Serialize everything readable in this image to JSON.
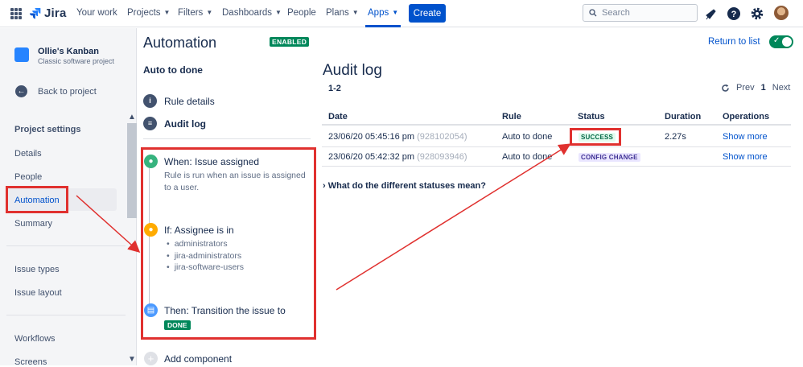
{
  "topnav": {
    "logo": "Jira",
    "items": [
      {
        "label": "Your work",
        "dropdown": false
      },
      {
        "label": "Projects",
        "dropdown": true
      },
      {
        "label": "Filters",
        "dropdown": true
      },
      {
        "label": "Dashboards",
        "dropdown": true
      },
      {
        "label": "People",
        "dropdown": false
      },
      {
        "label": "Plans",
        "dropdown": true
      },
      {
        "label": "Apps",
        "dropdown": true,
        "active": true
      }
    ],
    "create_label": "Create",
    "search_placeholder": "Search",
    "icons": [
      "app-switcher-icon",
      "notifications-icon",
      "help-icon",
      "settings-icon",
      "avatar"
    ]
  },
  "sidebar": {
    "project_name": "Ollie's Kanban",
    "project_type": "Classic software project",
    "back_label": "Back to project",
    "section_heading": "Project settings",
    "items": [
      "Details",
      "People",
      "Automation",
      "Summary",
      "Issue types",
      "Issue layout",
      "Workflows",
      "Screens"
    ],
    "active_item": "Automation"
  },
  "rule": {
    "page_title": "Automation",
    "status_badge": "ENABLED",
    "rule_name": "Auto to done",
    "menu": [
      {
        "label": "Rule details",
        "icon": "info-icon"
      },
      {
        "label": "Audit log",
        "icon": "list-icon",
        "active": true
      }
    ],
    "components": [
      {
        "title": "When: Issue assigned",
        "description": "Rule is run when an issue is assigned to a user.",
        "icon": "trigger-user-icon",
        "color": "#36b37e"
      },
      {
        "title": "If: Assignee is in",
        "list": [
          "administrators",
          "jira-administrators",
          "jira-software-users"
        ],
        "icon": "condition-user-icon",
        "color": "#ffab00"
      },
      {
        "title": "Then: Transition the issue to",
        "lozenge": "DONE",
        "icon": "action-transition-icon",
        "color": "#4c9aff"
      }
    ],
    "add_component_label": "Add component"
  },
  "audit": {
    "return_link": "Return to list",
    "title": "Audit log",
    "range": "1-2",
    "pager": {
      "prev": "Prev",
      "current": "1",
      "next": "Next"
    },
    "columns": [
      "Date",
      "Rule",
      "Status",
      "Duration",
      "Operations"
    ],
    "rows": [
      {
        "date": "23/06/20 05:45:16 pm",
        "id": "(928102054)",
        "rule": "Auto to done",
        "status": "SUCCESS",
        "duration": "2.27s",
        "operation": "Show more"
      },
      {
        "date": "23/06/20 05:42:32 pm",
        "id": "(928093946)",
        "rule": "Auto to done",
        "status": "CONFIG CHANGE",
        "duration": "",
        "operation": "Show more"
      }
    ],
    "faq": "What do the different statuses mean?"
  },
  "colors": {
    "brand": "#0052cc",
    "success": "#00875a",
    "annotation": "#e0312f"
  }
}
